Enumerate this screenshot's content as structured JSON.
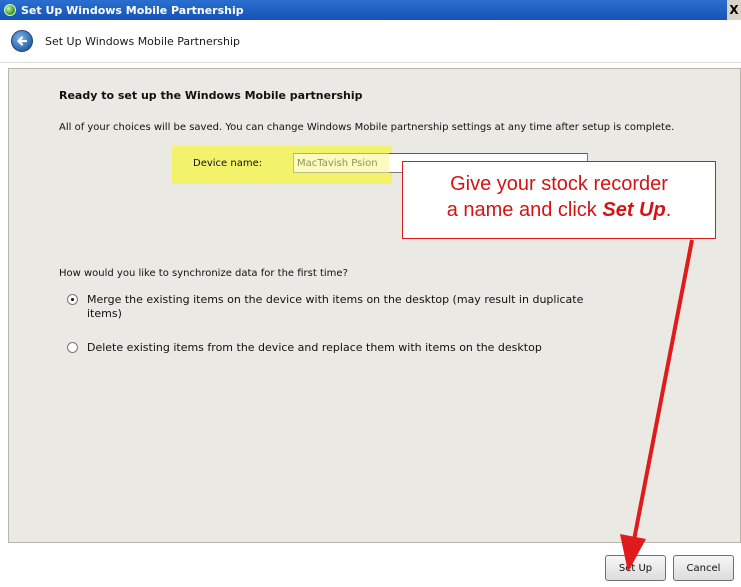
{
  "window": {
    "title": "Set Up Windows Mobile Partnership",
    "close_glyph": "X",
    "icon": "green-orb-icon"
  },
  "nav": {
    "back_icon": "back-arrow-icon",
    "breadcrumb": "Set Up Windows Mobile Partnership"
  },
  "main": {
    "heading": "Ready to set up the Windows Mobile partnership",
    "description": "All of your choices will be saved. You can change Windows Mobile partnership settings at any time after setup is complete.",
    "device_name_label": "Device name:",
    "device_name_value": "MacTavish Psion",
    "sync_question": "How would you like to synchronize data for the first time?",
    "options": [
      {
        "label": "Merge the existing items on the device with items on the desktop (may result in duplicate items)",
        "selected": true
      },
      {
        "label": "Delete existing items from the device and replace them with items on the desktop",
        "selected": false
      }
    ]
  },
  "annotation": {
    "line1": "Give your stock recorder",
    "line2_prefix": "a name and click ",
    "line2_emphasis": "Set Up",
    "line2_suffix": ".",
    "color": "#d41414"
  },
  "buttons": {
    "setup_label": "Set Up",
    "cancel_label": "Cancel"
  }
}
